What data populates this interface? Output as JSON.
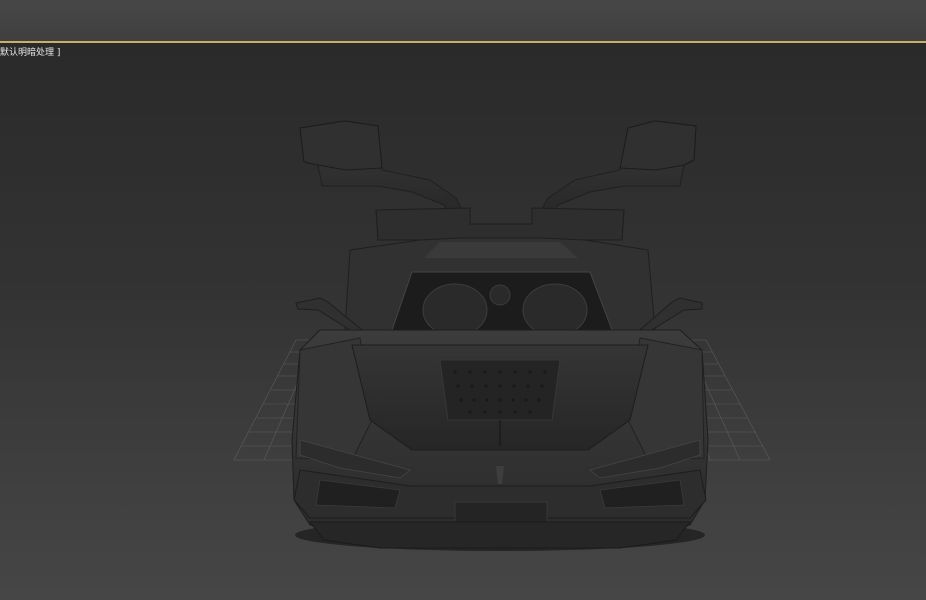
{
  "viewport": {
    "label": "默认明暗处理 ]",
    "scene_object": "sports-car-model",
    "border_color": "#c8b068",
    "background_top": "#2a2a2a",
    "background_bottom": "#464646"
  }
}
